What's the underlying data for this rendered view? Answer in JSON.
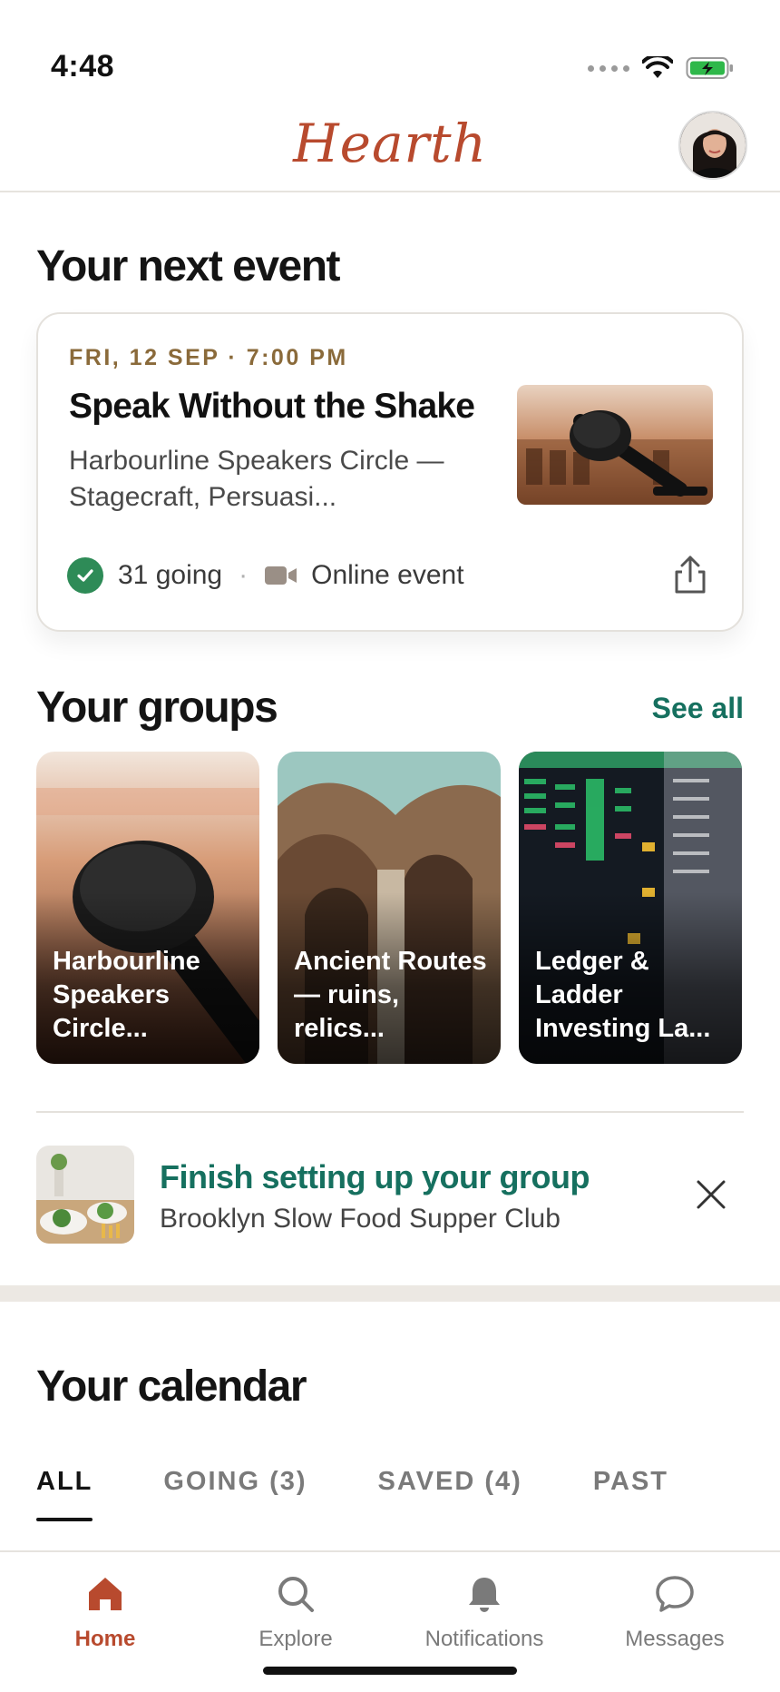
{
  "status_bar": {
    "time": "4:48"
  },
  "header": {
    "brand": "Hearth"
  },
  "next_event": {
    "section_title": "Your next event",
    "date": "FRI, 12 SEP · 7:00 PM",
    "title": "Speak Without the Shake",
    "description": "Harbourline Speakers Circle — Stagecraft, Persuasi...",
    "going": "31 going",
    "separator": "·",
    "location_type": "Online event"
  },
  "groups": {
    "section_title": "Your groups",
    "see_all": "See all",
    "items": [
      {
        "name": "Harbourline Speakers Circle..."
      },
      {
        "name": "Ancient Routes — ruins, relics..."
      },
      {
        "name": "Ledger & Ladder Investing La..."
      }
    ]
  },
  "setup_banner": {
    "title": "Finish setting up your group",
    "subtitle": "Brooklyn Slow Food Supper Club"
  },
  "calendar": {
    "section_title": "Your calendar",
    "tabs": [
      {
        "label": "ALL"
      },
      {
        "label": "GOING (3)"
      },
      {
        "label": "SAVED (4)"
      },
      {
        "label": "PAST"
      }
    ]
  },
  "bottom_nav": {
    "items": [
      {
        "label": "Home"
      },
      {
        "label": "Explore"
      },
      {
        "label": "Notifications"
      },
      {
        "label": "Messages"
      }
    ]
  },
  "colors": {
    "brand": "#b84a2e",
    "accent": "#16705f",
    "date": "#8a6a3a",
    "going_check": "#2e8b57"
  }
}
